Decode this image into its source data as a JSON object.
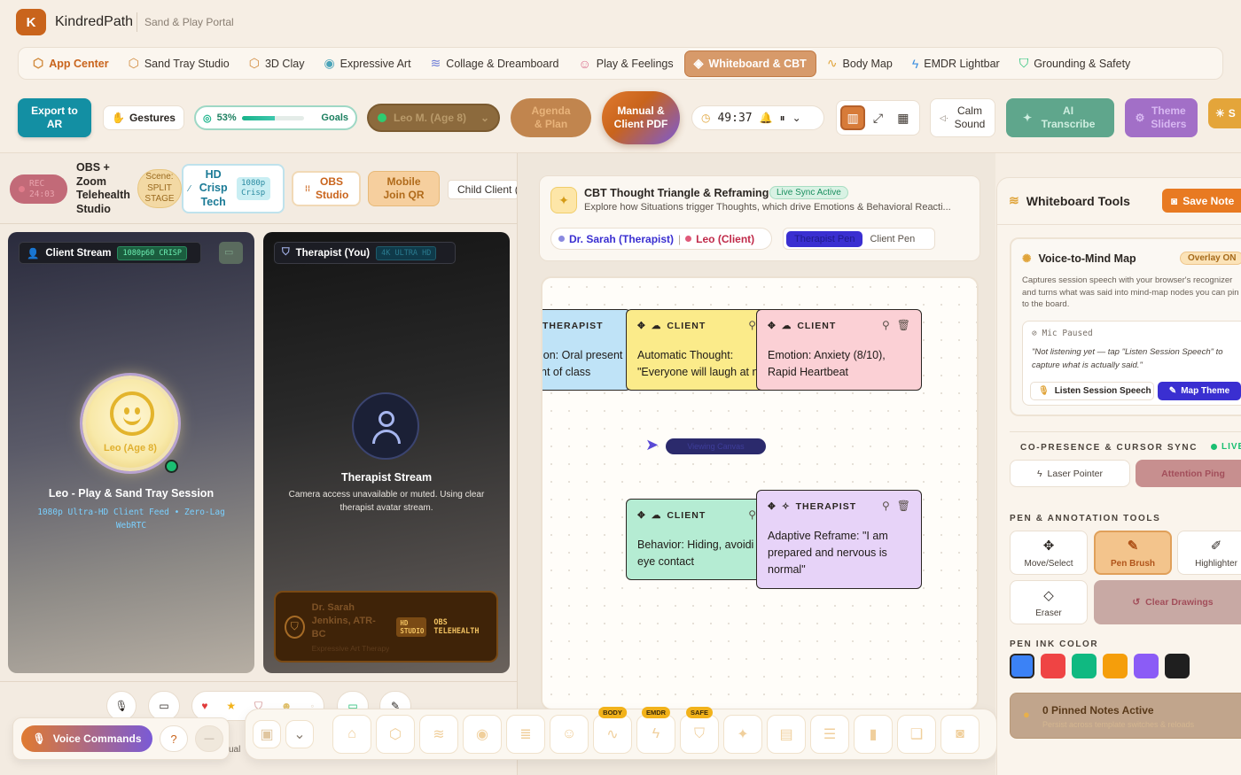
{
  "app": {
    "logo": "K",
    "name": "KindredPath",
    "portal": "Sand & Play Portal"
  },
  "nav": [
    {
      "label": "App Center",
      "icon": "cube-icon"
    },
    {
      "label": "Sand Tray Studio",
      "icon": "box-icon"
    },
    {
      "label": "3D Clay",
      "icon": "box-icon"
    },
    {
      "label": "Expressive Art",
      "icon": "palette-icon"
    },
    {
      "label": "Collage & Dreamboard",
      "icon": "layers-icon"
    },
    {
      "label": "Play & Feelings",
      "icon": "smile-icon"
    },
    {
      "label": "Whiteboard & CBT",
      "icon": "tag-icon",
      "active": true
    },
    {
      "label": "Body Map",
      "icon": "pulse-icon"
    },
    {
      "label": "EMDR Lightbar",
      "icon": "bolt-icon"
    },
    {
      "label": "Grounding & Safety",
      "icon": "shield-icon"
    }
  ],
  "toolbar": {
    "export": "Export to AR",
    "gestures": "Gestures",
    "goals_pct_label": "53%",
    "goals_progress": 0.53,
    "goals_label": "Goals",
    "client_select": "Leo M. (Age 8)",
    "agenda": "Agenda & Plan",
    "manual": "Manual & Client PDF",
    "timer": "49:37",
    "calm": "Calm Sound",
    "ai": "AI Transcribe",
    "theme": "Theme Sliders",
    "extra": "S"
  },
  "session_bar": {
    "rec_label": "REC",
    "rec_time": "24:03",
    "obs_title": "OBS + Zoom Telehealth Studio",
    "scene": "Scene: SPLIT STAGE",
    "hd_title": "HD Crisp Tech",
    "hd_badge": "1080p Crisp",
    "obs_studio": "OBS Studio",
    "mobile_qr": "Mobile Join QR",
    "child_client": "Child Client ("
  },
  "client_stream": {
    "header": "Client Stream",
    "badge": "1080p60 CRISP",
    "avatar_name": "Leo (Age 8)",
    "title": "Leo - Play & Sand Tray Session",
    "sub": "1080p Ultra-HD Client Feed • Zero-Lag WebRTC"
  },
  "therapist_stream": {
    "header": "Therapist (You)",
    "badge": "4K ULTRA HD",
    "title": "Therapist Stream",
    "sub": "Camera access unavailable or muted. Using clear therapist avatar stream.",
    "plate_name": "Dr. Sarah Jenkins, ATR-BC",
    "plate_sub": "Expressive Art Therapy",
    "plate_badge": "HD STUDIO",
    "plate_obs": "OBS TELEHEALTH"
  },
  "voice": {
    "label": "Voice Commands",
    "help": "?",
    "mini": "—",
    "partial": "ual"
  },
  "cbt": {
    "title": "CBT Thought Triangle & Reframing",
    "live": "Live Sync Active",
    "desc": "Explore how Situations trigger Thoughts, which drive Emotions & Behavioral Reacti...",
    "therapist": "Dr. Sarah (Therapist)",
    "client": "Leo (Client)",
    "pen_on": "Therapist Pen",
    "pen_off": "Client Pen"
  },
  "notes": [
    {
      "tag": "THERAPIST",
      "text": "ion: Oral present nt of class",
      "color": "#bfe3f7"
    },
    {
      "tag": "CLIENT",
      "text": "Automatic Thought: \"Everyone will laugh at n",
      "color": "#fbeb8a"
    },
    {
      "tag": "CLIENT",
      "text": "Emotion: Anxiety (8/10), Rapid Heartbeat",
      "color": "#fbd0d5"
    },
    {
      "tag": "CLIENT",
      "text": "Behavior: Hiding, avoidi eye contact",
      "color": "#b5ecd3"
    },
    {
      "tag": "THERAPIST",
      "text": "Adaptive Reframe: \"I am prepared and nervous is normal\"",
      "color": "#e7d3f8"
    }
  ],
  "cursor_tag": "Viewing Canvas",
  "dock_badges": [
    "BODY",
    "EMDR",
    "SAFE"
  ],
  "right": {
    "title": "Whiteboard Tools",
    "save": "Save Note",
    "v2m_title": "Voice-to-Mind Map",
    "overlay": "Overlay ON",
    "v2m_desc": "Captures session speech with your browser's recognizer and turns what was said into mind-map nodes you can pin to the board.",
    "mic_status": "Mic Paused",
    "mic_quote": "\"Not listening yet — tap \"Listen Session Speech\" to capture what is actually said.\"",
    "listen": "Listen Session Speech",
    "map_theme": "Map Theme",
    "copresence": "CO-PRESENCE & CURSOR SYNC",
    "live": "LIVE",
    "laser": "Laser Pointer",
    "attention": "Attention Ping",
    "pen_tools": "PEN & ANNOTATION TOOLS",
    "tools": [
      "Move/Select",
      "Pen Brush",
      "Highlighter",
      "Eraser"
    ],
    "clear": "Clear Drawings",
    "ink_label": "PEN INK COLOR",
    "ink_colors": [
      "#3b82f6",
      "#ef4444",
      "#10b981",
      "#f59e0b",
      "#8b5cf6",
      "#1f1f1f"
    ],
    "pinned": "0 Pinned Notes Active",
    "pinned_sub": "Persist across template switches & reloads"
  }
}
